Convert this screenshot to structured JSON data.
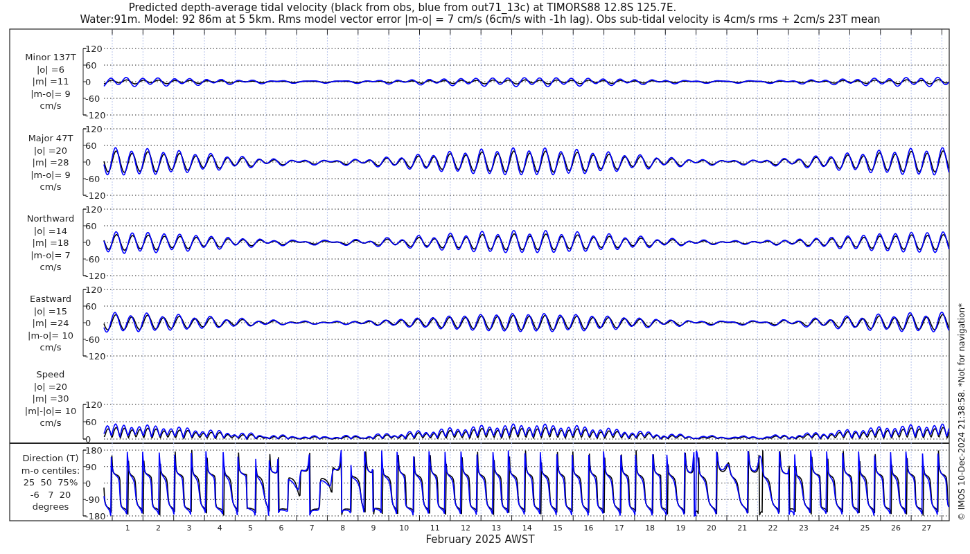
{
  "title_lines": [
    "Predicted depth-average tidal velocity (black from obs, blue from out71_13c) at TIMORS88 12.8S 125.7E.",
    "Water:91m. Model: 92 86m at 5 5km. Rms model vector error |m-o| = 7 cm/s (6cm/s with -1h lag). Obs sub-tidal velocity is 4cm/s rms + 2cm/s 23T mean"
  ],
  "panels": [
    {
      "kind": "minor",
      "label_lines": [
        "Minor 137T",
        "|o| =6",
        "|m| =11",
        "|m-o|= 9",
        "cm/s"
      ],
      "yticks": [
        "120",
        "60",
        "0",
        "-60",
        "-120"
      ]
    },
    {
      "kind": "major",
      "label_lines": [
        "Major 47T",
        "|o| =20",
        "|m| =28",
        "|m-o|= 9",
        "cm/s"
      ],
      "yticks": [
        "120",
        "60",
        "0",
        "-60",
        "-120"
      ]
    },
    {
      "kind": "north",
      "label_lines": [
        "Northward",
        "|o| =14",
        "|m| =18",
        "|m-o|= 7",
        "cm/s"
      ],
      "yticks": [
        "120",
        "60",
        "0",
        "-60",
        "-120"
      ]
    },
    {
      "kind": "east",
      "label_lines": [
        "Eastward",
        "|o| =15",
        "|m| =24",
        "|m-o|= 10",
        "cm/s"
      ],
      "yticks": [
        "120",
        "60",
        "0",
        "-60",
        "-120"
      ]
    },
    {
      "kind": "speed",
      "label_lines": [
        "Speed",
        "|o| =20",
        "|m| =30",
        "|m|-|o|= 10",
        "cm/s"
      ],
      "yticks": [
        "120",
        "60",
        "0"
      ]
    },
    {
      "kind": "direction",
      "label_lines": [
        "Direction (T)",
        "m-o centiles:",
        "25  50  75%",
        "-6   7  20",
        "degrees"
      ],
      "yticks": [
        "180",
        "90",
        "0",
        "-90",
        "-180"
      ]
    }
  ],
  "day_labels": [
    "1",
    "2",
    "3",
    "4",
    "5",
    "6",
    "7",
    "8",
    "9",
    "10",
    "11",
    "12",
    "13",
    "14",
    "15",
    "16",
    "17",
    "18",
    "19",
    "20",
    "21",
    "22",
    "23",
    "24",
    "25",
    "26",
    "27"
  ],
  "xlabel": "February 2025 AWST",
  "footer": "© IMOS 10-Dec-2024 21:38:58. *Not for navigation*"
}
